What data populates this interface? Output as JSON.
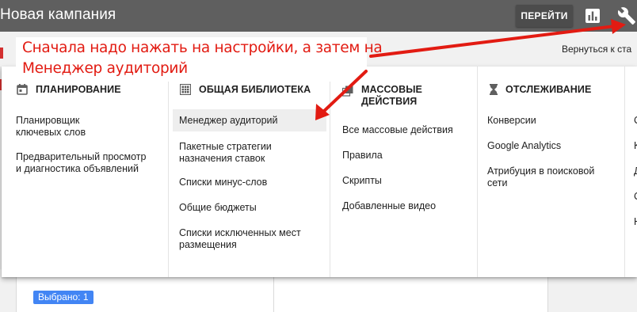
{
  "header": {
    "title": "Новая кампания",
    "go_button": "ПЕРЕЙТИ",
    "icons": [
      "reports-icon",
      "wrench-icon"
    ]
  },
  "back_link": "Вернуться к ста",
  "dropdown": {
    "columns": [
      {
        "title": "ПЛАНИРОВАНИЕ",
        "icon": "calendar-icon",
        "items": [
          "Планировщик\nключевых слов",
          "Предварительный просмотр\nи диагностика объявлений"
        ]
      },
      {
        "title": "ОБЩАЯ БИБЛИОТЕКА",
        "icon": "grid-icon",
        "items": [
          "Менеджер аудиторий",
          "Пакетные стратегии\nназначения ставок",
          "Списки минус-слов",
          "Общие бюджеты",
          "Списки исключенных мест\nразмещения"
        ],
        "highlighted": "Менеджер аудиторий"
      },
      {
        "title": "МАССОВЫЕ\nДЕЙСТВИЯ",
        "icon": "copy-icon",
        "items": [
          "Все массовые действия",
          "Правила",
          "Скрипты",
          "Добавленные видео"
        ]
      },
      {
        "title": "ОТСЛЕЖИВАНИЕ",
        "icon": "hourglass-icon",
        "items": [
          "Конверсии",
          "Google Analytics",
          "Атрибуция в поисковой\nсети"
        ]
      },
      {
        "title": "",
        "icon": "",
        "items": [
          "С",
          "К",
          "Д",
          "С",
          "Н"
        ]
      }
    ]
  },
  "background": {
    "selected_chip": "Выбрано: 1"
  },
  "annotation": {
    "text_line1": "Сначала надо нажать на настройки, а затем на",
    "text_line2": "Менеджер аудиторий",
    "color": "#e21b12"
  },
  "colors": {
    "topbar": "#5f5f5f",
    "highlight": "#eeeeee",
    "chip": "#4285f4"
  }
}
